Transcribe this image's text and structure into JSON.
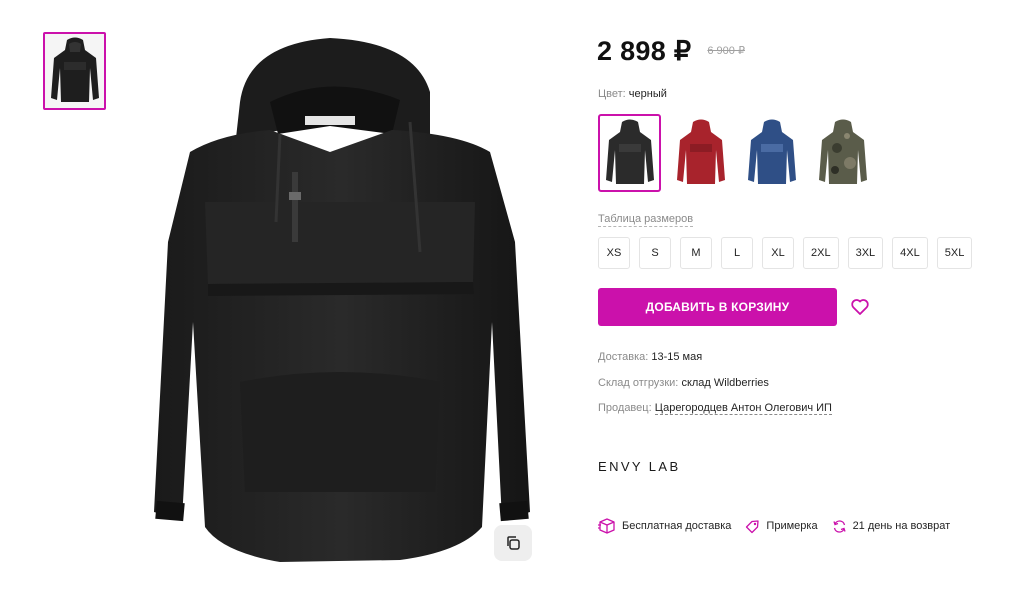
{
  "thumbnail": {
    "icon": "jacket-black-thumbnail"
  },
  "main_image": {
    "icon": "black-anorak-jacket",
    "label_tag": "ENVY LAB"
  },
  "price": {
    "current": "2 898 ₽",
    "old": "6 900 ₽"
  },
  "color": {
    "label": "Цвет:",
    "value": "черный",
    "swatches": [
      {
        "name": "black",
        "hex": "#2b2b2b"
      },
      {
        "name": "red",
        "hex": "#a8232c"
      },
      {
        "name": "blue",
        "hex": "#2f4f86"
      },
      {
        "name": "camo",
        "hex": "#5a5c4a"
      }
    ]
  },
  "sizes": {
    "table_link": "Таблица размеров",
    "items": [
      "XS",
      "S",
      "M",
      "L",
      "XL",
      "2XL",
      "3XL",
      "4XL",
      "5XL"
    ]
  },
  "cart": {
    "button_label": "ДОБАВИТЬ В КОРЗИНУ"
  },
  "delivery": {
    "label": "Доставка:",
    "value": "13-15 мая"
  },
  "warehouse": {
    "label": "Склад отгрузки:",
    "value": "склад Wildberries"
  },
  "seller": {
    "label": "Продавец:",
    "value": "Царегородцев Антон Олегович ИП"
  },
  "brand": {
    "name": "ENVY LAB"
  },
  "features": [
    {
      "icon": "box-icon",
      "label": "Бесплатная доставка"
    },
    {
      "icon": "tag-icon",
      "label": "Примерка"
    },
    {
      "icon": "refresh-icon",
      "label": "21 день на возврат"
    }
  ],
  "colors": {
    "accent": "#cb11ab",
    "muted": "#8a8a8a"
  }
}
